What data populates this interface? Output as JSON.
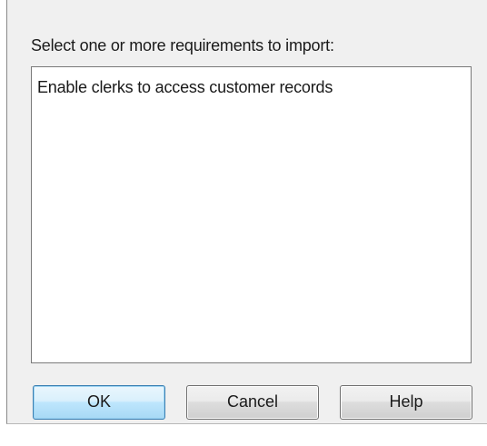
{
  "dialog": {
    "prompt": "Select one or more requirements to import:",
    "requirements": [
      "Enable clerks to access customer records"
    ],
    "buttons": {
      "ok_label": "OK",
      "cancel_label": "Cancel",
      "help_label": "Help"
    }
  }
}
